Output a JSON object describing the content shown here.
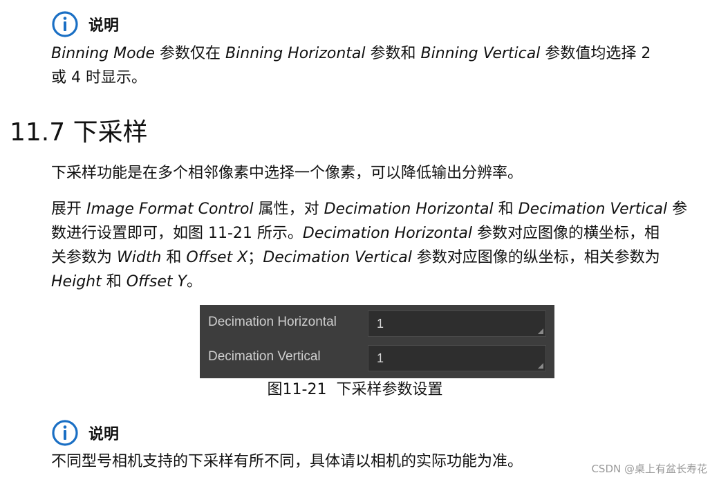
{
  "note1": {
    "title": "说明",
    "line1": {
      "t1": "Binning Mode",
      "t2": " 参数仅在 ",
      "t3": "Binning Horizontal",
      "t4": " 参数和 ",
      "t5": "Binning Vertical",
      "t6": " 参数值均选择 2"
    },
    "line2": "或 4 时显示。"
  },
  "section": {
    "heading": "11.7 下采样",
    "para1": "下采样功能是在多个相邻像素中选择一个像素，可以降低输出分辨率。",
    "para2": {
      "l1": {
        "a": "展开 ",
        "b": "Image Format Control",
        "c": " 属性，对 ",
        "d": "Decimation Horizontal",
        "e": " 和 ",
        "f": "Decimation Vertical",
        "g": " 参"
      },
      "l2": {
        "a": "数进行设置即可，如图 11-21 所示。",
        "b": "Decimation Horizontal",
        "c": " 参数对应图像的横坐标，相"
      },
      "l3": {
        "a": "关参数为 ",
        "b": "Width",
        "c": " 和 ",
        "d": "Offset X",
        "e": "；",
        "f": "Decimation Vertical",
        "g": " 参数对应图像的纵坐标，相关参数为"
      },
      "l4": {
        "a": "Height",
        "b": " 和 ",
        "c": "Offset Y",
        "d": "。"
      }
    }
  },
  "figure": {
    "rows": [
      {
        "label": "Decimation Horizontal",
        "value": "1"
      },
      {
        "label": "Decimation Vertical",
        "value": "1"
      }
    ],
    "caption": "图11-21  下采样参数设置"
  },
  "note2": {
    "title": "说明",
    "text": "不同型号相机支持的下采样有所不同，具体请以相机的实际功能为准。"
  },
  "watermark": "CSDN @桌上有盆长寿花",
  "icon_color": "#1a6fc4",
  "panel_bg": "#3d3d3d"
}
